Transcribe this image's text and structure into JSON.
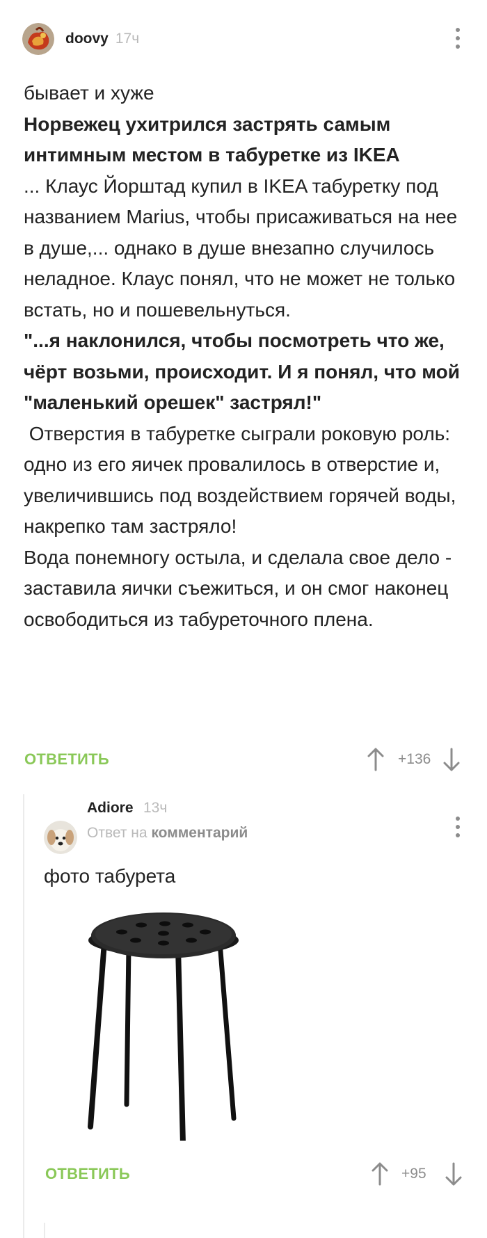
{
  "comment1": {
    "username": "doovy",
    "time": "17ч",
    "body": {
      "line1": "бывает и хуже",
      "headline": "Норвежец ухитрился застрять самым интимным местом в табуретке из IKEA",
      "para1": "... Клаус Йорштад купил в IKEA табуретку под названием Marius, чтобы присаживаться на нее в душе,... однако в душе внезапно случилось неладное. Клаус понял, что не может не только встать, но и пошевельнуться.",
      "quote": "\"...я наклонился, чтобы посмотреть что же, чёрт возьми, происходит. И я понял, что мой \"маленький орешек\" застрял!\"",
      "para2": " Отверстия в табуретке сыграли роковую роль:  одно из его яичек провалилось в отверстие и, увеличившись под воздействием горячей воды, накрепко там застряло!",
      "para3": "Вода понемногу остыла, и  сделала свое дело - заставила яички съежиться, и он смог наконец освободиться из табуреточного плена."
    },
    "reply_label": "ОТВЕТИТЬ",
    "score": "+136"
  },
  "comment2": {
    "username": "Adiore",
    "time": "13ч",
    "reply_to_prefix": "Ответ на",
    "reply_to_target": "комментарий",
    "body": "фото табурета",
    "reply_label": "ОТВЕТИТЬ",
    "score": "+95"
  },
  "icons": {
    "more": "more-vertical-icon",
    "up": "arrow-up-icon",
    "down": "arrow-down-icon"
  },
  "colors": {
    "reply": "#8ac858",
    "muted": "#b9b9b9",
    "icon": "#8c8c8c"
  }
}
